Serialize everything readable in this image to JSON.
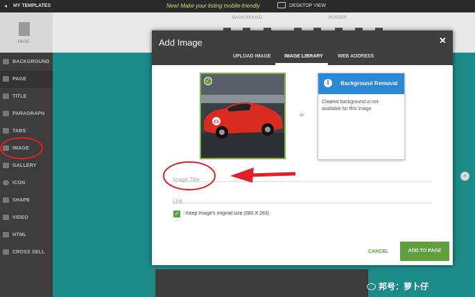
{
  "topbar": {
    "back_glyph": "◂",
    "my_templates": "MY TEMPLATES",
    "promo": "New! Make your listing mobile-friendly",
    "desktop_view": "DESKTOP VIEW"
  },
  "toolbar": {
    "page_label": "PAGE",
    "group_background": "BACKGROUND",
    "group_border": "BORDER"
  },
  "sidebar": {
    "items": [
      {
        "label": "BACKGROUND",
        "icon": "background-icon"
      },
      {
        "label": "PAGE",
        "icon": "page-icon"
      },
      {
        "label": "TITLE",
        "icon": "title-icon"
      },
      {
        "label": "PARAGRAPH",
        "icon": "paragraph-icon"
      },
      {
        "label": "TABS",
        "icon": "tabs-icon"
      },
      {
        "label": "IMAGE",
        "icon": "image-icon"
      },
      {
        "label": "GALLERY",
        "icon": "gallery-icon"
      },
      {
        "label": "ICON",
        "icon": "smiley-icon"
      },
      {
        "label": "SHAPE",
        "icon": "shape-icon"
      },
      {
        "label": "VIDEO",
        "icon": "video-icon"
      },
      {
        "label": "HTML",
        "icon": "html-icon"
      },
      {
        "label": "CROSS SELL",
        "icon": "cross-sell-icon"
      }
    ]
  },
  "modal": {
    "title": "Add Image",
    "close_glyph": "✕",
    "tabs": [
      {
        "label": "UPLOAD IMAGE"
      },
      {
        "label": "IMAGE LIBRARY"
      },
      {
        "label": "WEB ADDRESS"
      }
    ],
    "check_glyph": "✓",
    "or_text": "or",
    "background_removal": {
      "info_glyph": "i",
      "title": "Background Removal",
      "message": "Cleared background is not available for this image"
    },
    "image_title_placeholder": "Image Title",
    "link_placeholder": "Link",
    "keep_size_label": "Keep Image's original size (580 X 283)",
    "cancel_label": "CANCEL",
    "add_label": "ADD TO PAGE"
  },
  "watermark": "邦号：萝卜仔",
  "colors": {
    "accent_green": "#5f9f3c",
    "canvas_teal": "#1b8b88",
    "info_blue": "#2b88d8",
    "annotation_red": "#e0202a"
  }
}
